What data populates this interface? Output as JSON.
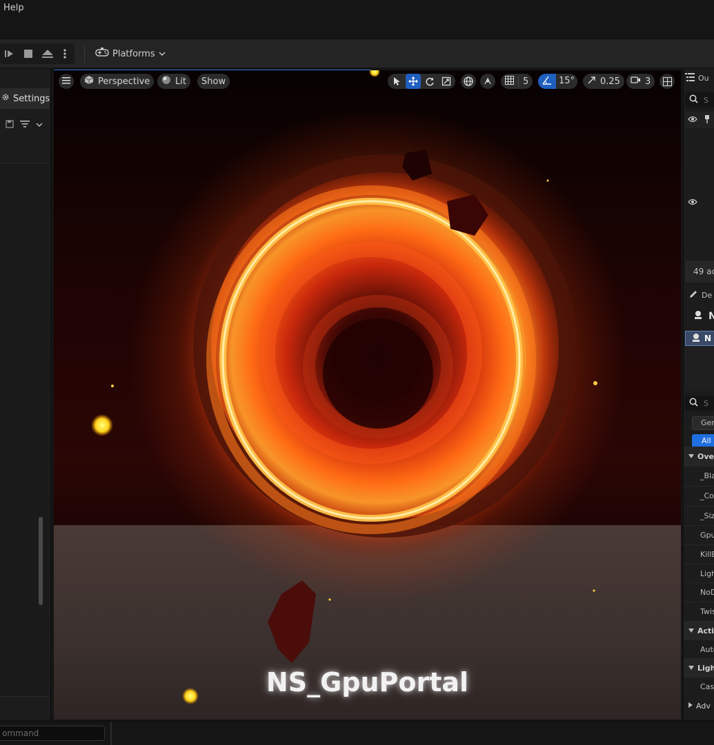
{
  "menubar": {
    "help": "Help"
  },
  "toolbar": {
    "platforms_label": "Platforms"
  },
  "left_panel": {
    "settings_label": "Settings"
  },
  "viewport": {
    "perspective_label": "Perspective",
    "lit_label": "Lit",
    "show_label": "Show",
    "grid_snap_value": "5",
    "angle_snap_value": "15°",
    "scale_snap_value": "0.25",
    "camera_speed_value": "3",
    "overlay_text": "NS_GpuPortal"
  },
  "right_panel": {
    "outliner_tab": "Ou",
    "search_placeholder": "S",
    "actor_count": "49 ac",
    "details_tab": "De",
    "selected_name": "N",
    "component_name": "N",
    "details_search": "S",
    "filter_general": "Gen",
    "filter_all": "All",
    "categories": [
      {
        "label": "Ove"
      },
      {
        "label": "Acti"
      },
      {
        "label": "Ligh"
      }
    ],
    "properties_override": [
      "_Bla",
      "_Col",
      "_Siz",
      "Gpu",
      "KillB",
      "Ligh",
      "NoD",
      "Twis"
    ],
    "properties_actor": [
      "Auto"
    ],
    "properties_lighting": [
      "Cas"
    ],
    "advanced": "Adv"
  },
  "bottom_bar": {
    "command_placeholder": "ommand"
  },
  "colors": {
    "accent_blue": "#1f5fbf",
    "portal_orange": "#ff7a1a",
    "portal_core": "#ffe27a"
  }
}
